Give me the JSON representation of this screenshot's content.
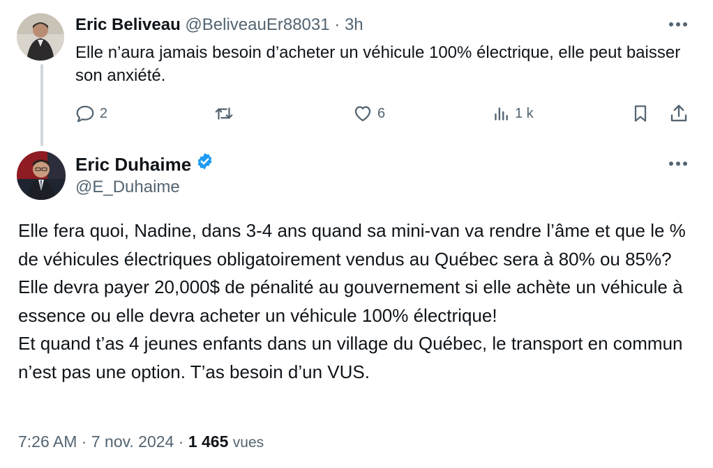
{
  "reply": {
    "author_name": "Eric Beliveau",
    "handle": "@BeliveauEr88031",
    "separator": "·",
    "time": "3h",
    "text": "Elle n’aura jamais besoin d’acheter un véhicule 100% électrique, elle peut baisser son anxiété.",
    "counts": {
      "replies": "2",
      "likes": "6",
      "views": "1 k"
    },
    "icons": [
      "reply-icon",
      "retweet-icon",
      "like-icon",
      "views-icon",
      "bookmark-icon",
      "share-icon",
      "more-icon"
    ]
  },
  "main": {
    "author_name": "Eric Duhaime",
    "handle": "@E_Duhaime",
    "verified": true,
    "text_p1": "Elle fera quoi, Nadine, dans 3-4 ans quand sa mini-van va rendre l’âme et que le % de véhicules électriques obligatoirement vendus au Québec sera à 80% ou 85%? Elle devra payer 20,000$ de pénalité au gouvernement si elle achète un véhicule à essence ou elle devra acheter un véhicule 100% électrique!",
    "text_p2": "Et quand t’as 4 jeunes enfants dans un village du Québec, le transport en commun n’est pas une option. T’as besoin d’un VUS.",
    "time": "7:26 AM",
    "date": "7 nov. 2024",
    "dot": "·",
    "views_count": "1 465",
    "views_label": "vues"
  },
  "colors": {
    "text": "#0f1419",
    "muted": "#536471",
    "verified": "#1d9bf0",
    "thread_line": "#cfd9de"
  }
}
